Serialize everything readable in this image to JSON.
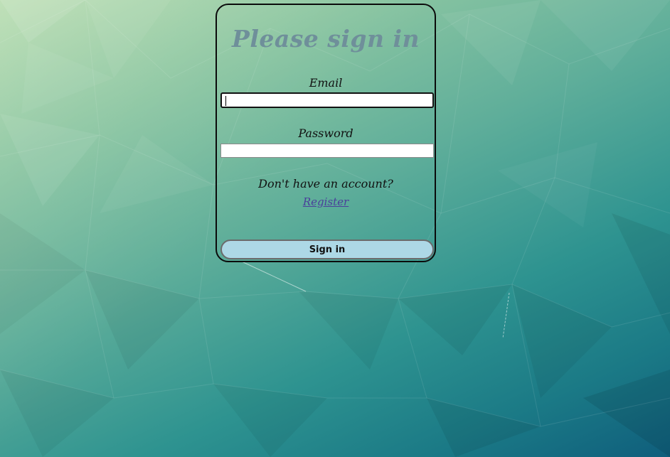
{
  "page": {
    "title": "Please sign in"
  },
  "form": {
    "email_label": "Email",
    "email_value": "",
    "password_label": "Password",
    "password_value": "",
    "register_prompt": "Don't have an account?",
    "register_link": "Register",
    "submit_label": "Sign in"
  },
  "colors": {
    "title": "#6f8f9a",
    "button_bg": "#add8e6",
    "link": "#4a3f9a",
    "card_border": "#0b0b0b"
  }
}
